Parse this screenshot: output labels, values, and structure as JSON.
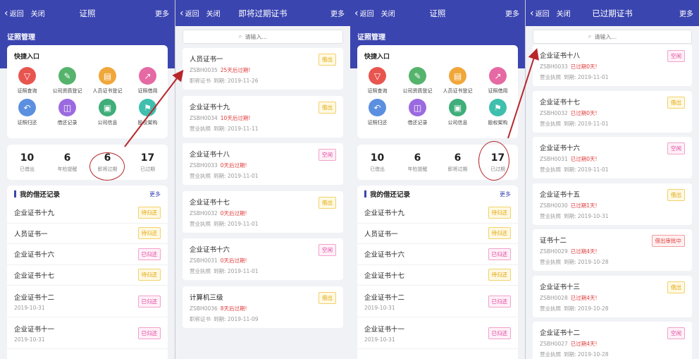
{
  "icons": {
    "query": "filter-icon",
    "qual": "pencil-icon",
    "personal": "id-card-icon",
    "borrow": "share-icon",
    "return": "undo-icon",
    "record": "record-icon",
    "info": "briefcase-icon",
    "org": "flag-icon"
  },
  "colors": {
    "primary": "#3b45b0",
    "arrow": "#b8262a"
  },
  "common": {
    "back": "返回",
    "close": "关闭",
    "more": "更多",
    "search_placeholder": "请输入..."
  },
  "p1": {
    "title": "证照",
    "section": "证照管理",
    "quick_title": "快捷入口",
    "quick": [
      {
        "label": "证照查询",
        "color": "#e8554f",
        "glyph": "▽"
      },
      {
        "label": "公司资质登记",
        "color": "#55b36c",
        "glyph": "✎"
      },
      {
        "label": "人员证书登记",
        "color": "#f0a73a",
        "glyph": "▤"
      },
      {
        "label": "证照借用",
        "color": "#e56aa3",
        "glyph": "↗"
      },
      {
        "label": "证照归还",
        "color": "#5b8fe0",
        "glyph": "↶"
      },
      {
        "label": "借还记录",
        "color": "#9b6ae0",
        "glyph": "◫"
      },
      {
        "label": "公司信息",
        "color": "#3fae7a",
        "glyph": "▣"
      },
      {
        "label": "股权架构",
        "color": "#3fbfae",
        "glyph": "⚑"
      }
    ],
    "stats": [
      {
        "num": "10",
        "label": "已借出"
      },
      {
        "num": "6",
        "label": "年检提醒"
      },
      {
        "num": "6",
        "label": "即将过期"
      },
      {
        "num": "17",
        "label": "已过期"
      }
    ],
    "borrow_title": "我的借还记录",
    "borrow_more": "更多",
    "rows": [
      {
        "name": "企业证书十九",
        "date": "",
        "tag": "待归还",
        "cls": "tag-yellow"
      },
      {
        "name": "人员证书一",
        "date": "",
        "tag": "待归还",
        "cls": "tag-yellow"
      },
      {
        "name": "企业证书十六",
        "date": "",
        "tag": "已归还",
        "cls": "tag-pink"
      },
      {
        "name": "企业证书十七",
        "date": "",
        "tag": "待归还",
        "cls": "tag-yellow"
      },
      {
        "name": "企业证书十二",
        "date": "2019-10-31",
        "tag": "已归还",
        "cls": "tag-pink"
      },
      {
        "name": "企业证书十一",
        "date": "2019-10-31",
        "tag": "已归还",
        "cls": "tag-pink"
      }
    ]
  },
  "p2": {
    "title": "即将过期证书",
    "items": [
      {
        "name": "人员证书一",
        "code": "ZSBH0035",
        "warn": "25天后过期!",
        "type": "职称证书",
        "expiry": "到期: 2019-11-26",
        "tag": "借出",
        "cls": "tag-yellow"
      },
      {
        "name": "企业证书十九",
        "code": "ZSBH0034",
        "warn": "10天后过期!",
        "type": "营业执照",
        "expiry": "到期: 2019-11-11",
        "tag": "借出",
        "cls": "tag-yellow"
      },
      {
        "name": "企业证书十八",
        "code": "ZSBH0033",
        "warn": "0天后过期!",
        "type": "营业执照",
        "expiry": "到期: 2019-11-01",
        "tag": "空闲",
        "cls": "tag-pink"
      },
      {
        "name": "企业证书十七",
        "code": "ZSBH0032",
        "warn": "0天后过期!",
        "type": "营业执照",
        "expiry": "到期: 2019-11-01",
        "tag": "借出",
        "cls": "tag-yellow"
      },
      {
        "name": "企业证书十六",
        "code": "ZSBH0031",
        "warn": "0天后过期!",
        "type": "营业执照",
        "expiry": "到期: 2019-11-01",
        "tag": "空闲",
        "cls": "tag-pink"
      },
      {
        "name": "计算机三级",
        "code": "ZSBH0036",
        "warn": "8天后过期!",
        "type": "职称证书",
        "expiry": "到期: 2019-11-09",
        "tag": "借出",
        "cls": "tag-yellow"
      }
    ]
  },
  "p3": {
    "title": "证照",
    "section": "证照管理",
    "quick_title": "快捷入口",
    "stats": [
      {
        "num": "10",
        "label": "已借出"
      },
      {
        "num": "6",
        "label": "年检提醒"
      },
      {
        "num": "6",
        "label": "即将过期"
      },
      {
        "num": "17",
        "label": "已过期"
      }
    ],
    "borrow_title": "我的借还记录",
    "borrow_more": "更多",
    "rows": [
      {
        "name": "企业证书十九",
        "date": "",
        "tag": "待归还",
        "cls": "tag-yellow"
      },
      {
        "name": "人员证书一",
        "date": "",
        "tag": "待归还",
        "cls": "tag-yellow"
      },
      {
        "name": "企业证书十六",
        "date": "",
        "tag": "已归还",
        "cls": "tag-pink"
      },
      {
        "name": "企业证书十七",
        "date": "",
        "tag": "待归还",
        "cls": "tag-yellow"
      },
      {
        "name": "企业证书十二",
        "date": "2019-10-31",
        "tag": "已归还",
        "cls": "tag-pink"
      },
      {
        "name": "企业证书十一",
        "date": "2019-10-31",
        "tag": "已归还",
        "cls": "tag-pink"
      }
    ]
  },
  "p4": {
    "title": "已过期证书",
    "items": [
      {
        "name": "企业证书十八",
        "code": "ZSBH0033",
        "warn": "已过期0天!",
        "type": "营业执照",
        "expiry": "到期: 2019-11-01",
        "tag": "空闲",
        "cls": "tag-pink"
      },
      {
        "name": "企业证书十七",
        "code": "ZSBH0032",
        "warn": "已过期0天!",
        "type": "营业执照",
        "expiry": "到期: 2019-11-01",
        "tag": "借出",
        "cls": "tag-yellow"
      },
      {
        "name": "企业证书十六",
        "code": "ZSBH0031",
        "warn": "已过期0天!",
        "type": "营业执照",
        "expiry": "到期: 2019-11-01",
        "tag": "空闲",
        "cls": "tag-pink"
      },
      {
        "name": "企业证书十五",
        "code": "ZSBH0030",
        "warn": "已过期1天!",
        "type": "营业执照",
        "expiry": "到期: 2019-10-31",
        "tag": "借出",
        "cls": "tag-yellow"
      },
      {
        "name": "证书十二",
        "code": "ZSBH0029",
        "warn": "已过期4天!",
        "type": "营业执照",
        "expiry": "到期: 2019-10-28",
        "tag": "借出审批中",
        "cls": "tag-red"
      },
      {
        "name": "企业证书十三",
        "code": "ZSBH0028",
        "warn": "已过期4天!",
        "type": "营业执照",
        "expiry": "到期: 2019-10-28",
        "tag": "借出",
        "cls": "tag-yellow"
      },
      {
        "name": "企业证书十二",
        "code": "ZSBH0027",
        "warn": "已过期4天!",
        "type": "营业执照",
        "expiry": "到期: 2019-10-28",
        "tag": "空闲",
        "cls": "tag-pink"
      }
    ]
  }
}
